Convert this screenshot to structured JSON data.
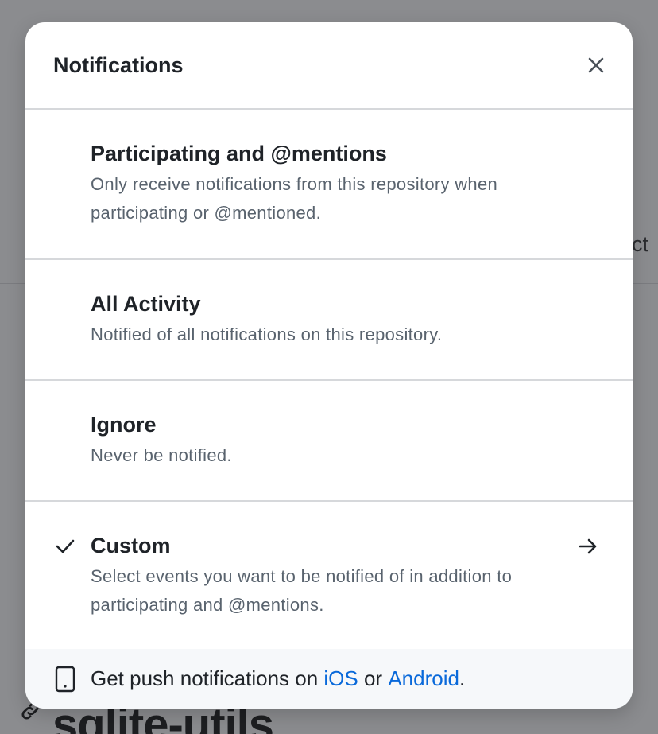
{
  "background": {
    "partial_text": "ect",
    "repo_title": "sqlite-utils"
  },
  "dialog": {
    "title": "Notifications",
    "close_icon": "close-icon",
    "options": [
      {
        "title": "Participating and @mentions",
        "description": "Only receive notifications from this repository when participating or @mentioned.",
        "selected": false
      },
      {
        "title": "All Activity",
        "description": "Notified of all notifications on this repository.",
        "selected": false
      },
      {
        "title": "Ignore",
        "description": "Never be notified.",
        "selected": false
      },
      {
        "title": "Custom",
        "description": "Select events you want to be notified of in addition to participating and @mentions.",
        "selected": true,
        "trailing_icon": "arrow-right-icon"
      }
    ],
    "footer": {
      "icon": "phone-icon",
      "text_before": "Get push notifications on ",
      "ios_link": "iOS",
      "text_middle": " or ",
      "android_link": "Android",
      "text_after": "."
    }
  },
  "colors": {
    "accent_link": "#0969da",
    "text_primary": "#1f2328",
    "text_secondary": "#59636e",
    "overlay": "#8b8c8f"
  }
}
